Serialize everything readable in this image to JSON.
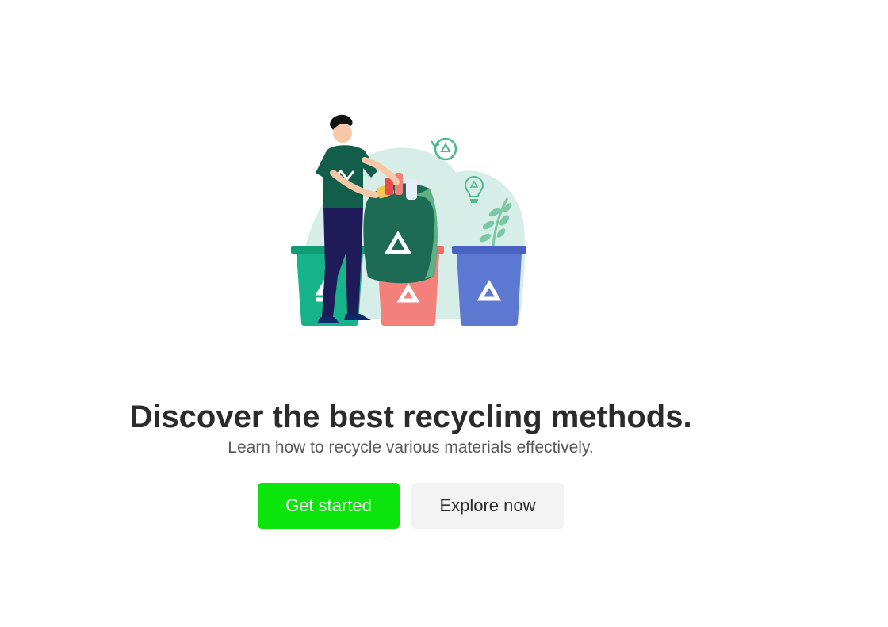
{
  "hero": {
    "illustration": "person-recycling-trash-into-bins",
    "headline": "Discover the best recycling methods.",
    "subheadline": "Learn how to recycle various materials effectively."
  },
  "actions": {
    "get_started_label": "Get started",
    "explore_now_label": "Explore now"
  },
  "colors": {
    "primary_button": "#0ce50c",
    "secondary_button": "#f3f3f3",
    "headline_text": "#2b2b2b",
    "bin_green": "#17b38a",
    "bin_red": "#f4807b",
    "bin_blue": "#5d78d0",
    "bag_green": "#1e6b55",
    "background_blob": "#d6ede8"
  },
  "icons": [
    "recycle-cycle-icon",
    "lightbulb-recycle-icon",
    "recycle-symbol-icon",
    "plant-leaves-icon"
  ]
}
